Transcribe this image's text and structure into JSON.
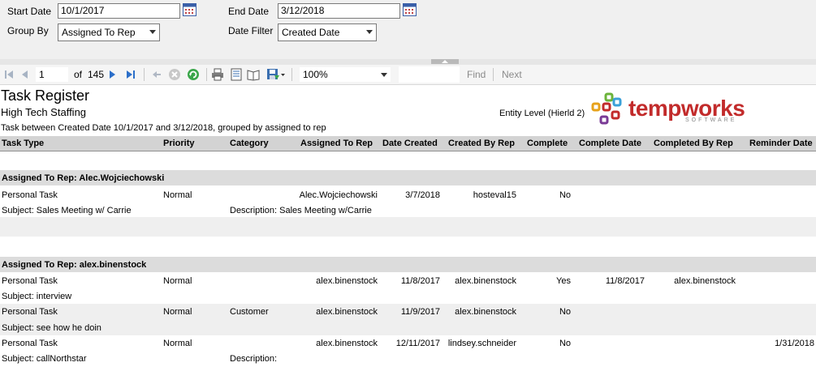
{
  "params": {
    "start_date_label": "Start Date",
    "start_date_value": "10/1/2017",
    "end_date_label": "End Date",
    "end_date_value": "3/12/2018",
    "group_by_label": "Group By",
    "group_by_value": "Assigned To Rep",
    "date_filter_label": "Date Filter",
    "date_filter_value": "Created Date"
  },
  "toolbar": {
    "page_value": "1",
    "of_label": "of",
    "total_pages": "145",
    "zoom_value": "100%",
    "find_label": "Find",
    "next_label": "Next"
  },
  "report": {
    "title": "Task Register",
    "company": "High Tech Staffing",
    "subtitle": "Task between Created Date 10/1/2017 and 3/12/2018, grouped by assigned to rep",
    "entity_level": "Entity Level (Hierld 2)",
    "logo_text": "tempworks",
    "logo_sub": "SOFTWARE",
    "columns": [
      "Task Type",
      "Priority",
      "Category",
      "Assigned To Rep",
      "Date Created",
      "Created By Rep",
      "Complete",
      "Complete Date",
      "Completed By Rep",
      "Reminder Date"
    ],
    "groups": [
      {
        "label": "Assigned To Rep: Alec.Wojciechowski",
        "rows": [
          {
            "type": "Personal Task",
            "priority": "Normal",
            "category": "",
            "assigned": "Alec.Wojciechowski",
            "created": "3/7/2018",
            "created_by": "hosteval15",
            "complete": "No",
            "complete_date": "",
            "completed_by": "",
            "reminder": "",
            "subject": "Subject: Sales Meeting w/ Carrie",
            "description": "Description: Sales Meeting w/Carrie"
          }
        ]
      },
      {
        "label": "Assigned To Rep: alex.binenstock",
        "rows": [
          {
            "type": "Personal Task",
            "priority": "Normal",
            "category": "",
            "assigned": "alex.binenstock",
            "created": "11/8/2017",
            "created_by": "alex.binenstock",
            "complete": "Yes",
            "complete_date": "11/8/2017",
            "completed_by": "alex.binenstock",
            "reminder": "",
            "subject": "Subject: interview",
            "description": ""
          },
          {
            "type": "Personal Task",
            "priority": "Normal",
            "category": "Customer",
            "assigned": "alex.binenstock",
            "created": "11/9/2017",
            "created_by": "alex.binenstock",
            "complete": "No",
            "complete_date": "",
            "completed_by": "",
            "reminder": "",
            "subject": "Subject: see how he doin",
            "description": ""
          },
          {
            "type": "Personal Task",
            "priority": "Normal",
            "category": "",
            "assigned": "alex.binenstock",
            "created": "12/11/2017",
            "created_by": "lindsey.schneider",
            "complete": "No",
            "complete_date": "",
            "completed_by": "",
            "reminder": "1/31/2018",
            "subject": "Subject: callNorthstar",
            "description": "Description:"
          }
        ]
      }
    ]
  }
}
